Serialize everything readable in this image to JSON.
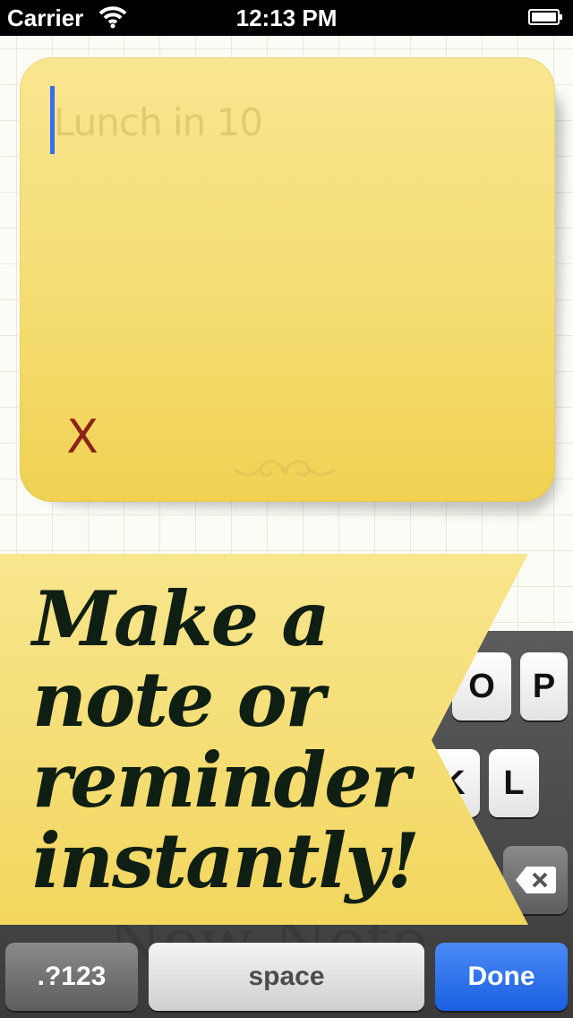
{
  "status_bar": {
    "carrier": "Carrier",
    "time": "12:13 PM",
    "icons": [
      "wifi-icon",
      "battery-icon"
    ]
  },
  "note": {
    "text": "Lunch in 10",
    "delete_label": "X",
    "colors": {
      "paper": "#f5dd73",
      "delete": "#8c2318",
      "cursor": "#3a6cf0"
    }
  },
  "banner": {
    "lines": [
      "Make a",
      "note or",
      "reminder",
      "instantly!"
    ],
    "color": "#f6e07a"
  },
  "keyboard": {
    "visible_keys": [
      "O",
      "P",
      "K",
      "L"
    ],
    "backspace_icon": "backspace-icon",
    "numbers_label": ".?123",
    "space_label": "space",
    "done_label": "Done",
    "colors": {
      "done": "#1a5fe0"
    }
  },
  "background_label": "New Note"
}
